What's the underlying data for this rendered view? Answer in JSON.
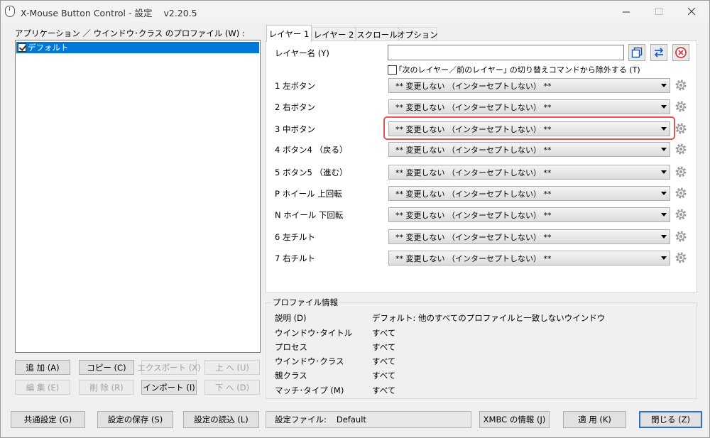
{
  "window": {
    "title": "X-Mouse Button Control - 設定",
    "version": "v2.20.5"
  },
  "profiles": {
    "label": "アプリケーション ／ ウインドウ･クラス のプロファイル (W) :",
    "items": [
      "デフォルト"
    ]
  },
  "left_buttons": {
    "add": "追 加  (A)",
    "copy": "コピー  (C)",
    "export": "エクスポート (X)",
    "up": "上 へ  (U)",
    "edit": "編 集  (E)",
    "delete": "削 除  (R)",
    "import": "インポート  (I)",
    "down": "下 へ  (D)"
  },
  "tabs": [
    "レイヤー 1",
    "レイヤー 2",
    "スクロール",
    "オプション"
  ],
  "layer": {
    "name_label": "レイヤー名 (Y)",
    "name_value": "",
    "exclude_label": "｢次のレイヤー／前のレイヤー｣ の切り替えコマンドから除外する  (T)"
  },
  "buttons": [
    {
      "label": "1  左ボタン",
      "value": "** 変更しない （インターセプトしない） **"
    },
    {
      "label": "2  右ボタン",
      "value": "** 変更しない （インターセプトしない） **"
    },
    {
      "label": "3  中ボタン",
      "value": "** 変更しない （インターセプトしない） **"
    },
    {
      "label": "4  ボタン4 （戻る）",
      "value": "** 変更しない （インターセプトしない） **"
    },
    {
      "label": "5  ボタン5 （進む）",
      "value": "** 変更しない （インターセプトしない） **"
    },
    {
      "label": "P  ホイール 上回転",
      "value": "** 変更しない （インターセプトしない） **"
    },
    {
      "label": "N  ホイール 下回転",
      "value": "** 変更しない （インターセプトしない） **"
    },
    {
      "label": "6  左チルト",
      "value": "** 変更しない （インターセプトしない） **"
    },
    {
      "label": "7  右チルト",
      "value": "** 変更しない （インターセプトしない） **"
    }
  ],
  "profile_info": {
    "title": "プロファイル情報",
    "rows": [
      {
        "label": "説明 (D)",
        "value": "デフォルト: 他のすべてのプロファイルと一致しないウインドウ"
      },
      {
        "label": "ウインドウ･タイトル",
        "value": "すべて"
      },
      {
        "label": "プロセス",
        "value": "すべて"
      },
      {
        "label": "ウインドウ･クラス",
        "value": "すべて"
      },
      {
        "label": "親クラス",
        "value": "すべて"
      },
      {
        "label": "マッチ･タイプ (M)",
        "value": "すべて"
      }
    ]
  },
  "bottom": {
    "common": "共通設定 (G)",
    "save": "設定の保存 (S)",
    "load": "設定の読込 (L)",
    "config_label": "設定ファイル:",
    "config_value": "Default",
    "about": "XMBC の情報 (J)",
    "apply": "適 用  (K)",
    "close": "閉じる (Z)"
  },
  "colors": {
    "selection": "#0078d7",
    "highlight": "#e0574f",
    "swap_icon": "#1a5fd6",
    "delete_icon": "#d83b3b"
  }
}
